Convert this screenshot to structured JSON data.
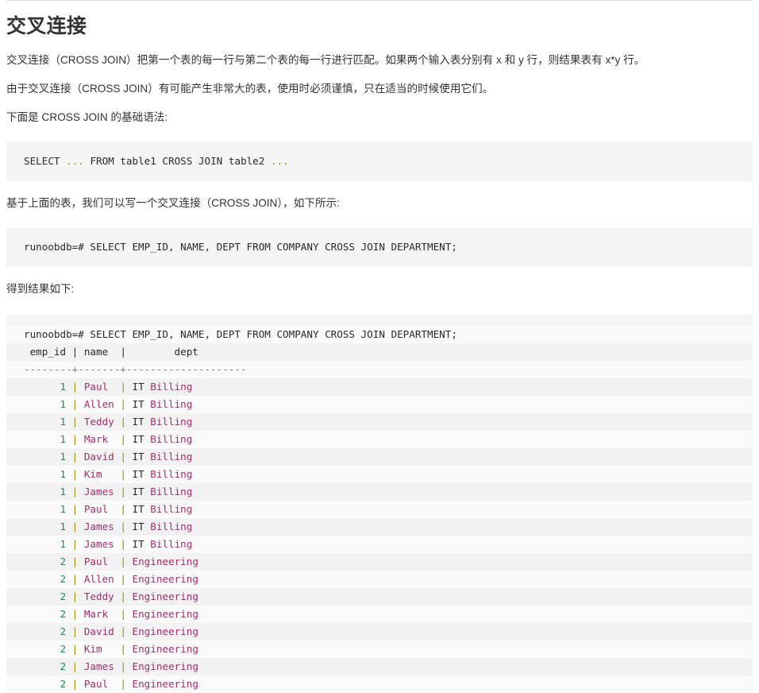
{
  "page": {
    "title": "交叉连接",
    "paragraphs": [
      "交叉连接（CROSS JOIN）把第一个表的每一行与第二个表的每一行进行匹配。如果两个输入表分别有 x 和 y 行，则结果表有 x*y 行。",
      "由于交叉连接（CROSS JOIN）有可能产生非常大的表，使用时必须谨慎，只在适当的时候使用它们。",
      "下面是 CROSS JOIN 的基础语法:",
      "基于上面的表，我们可以写一个交叉连接（CROSS JOIN），如下所示:",
      "得到结果如下:"
    ]
  },
  "syntax_code": {
    "line": "SELECT ... FROM table1 CROSS JOIN table2 ...",
    "keyword_select": "SELECT",
    "dots1": "...",
    "rest": "FROM table1 CROSS JOIN table2",
    "dots2": "..."
  },
  "example_code": {
    "line": "runoobdb=# SELECT EMP_ID, NAME, DEPT FROM COMPANY CROSS JOIN DEPARTMENT;"
  },
  "result": {
    "prompt_line": "runoobdb=# SELECT EMP_ID, NAME, DEPT FROM COMPANY CROSS JOIN DEPARTMENT;",
    "header": " emp_id | name  |        dept",
    "separator": "--------+-------+--------------------",
    "columns": [
      "emp_id",
      "name",
      "dept"
    ],
    "rows": [
      {
        "emp_id": "1",
        "name": "Paul ",
        "dept_plain": "IT ",
        "dept_hl": "Billing"
      },
      {
        "emp_id": "1",
        "name": "Allen",
        "dept_plain": "IT ",
        "dept_hl": "Billing"
      },
      {
        "emp_id": "1",
        "name": "Teddy",
        "dept_plain": "IT ",
        "dept_hl": "Billing"
      },
      {
        "emp_id": "1",
        "name": "Mark ",
        "dept_plain": "IT ",
        "dept_hl": "Billing"
      },
      {
        "emp_id": "1",
        "name": "David",
        "dept_plain": "IT ",
        "dept_hl": "Billing"
      },
      {
        "emp_id": "1",
        "name": "Kim  ",
        "dept_plain": "IT ",
        "dept_hl": "Billing"
      },
      {
        "emp_id": "1",
        "name": "James",
        "dept_plain": "IT ",
        "dept_hl": "Billing"
      },
      {
        "emp_id": "1",
        "name": "Paul ",
        "dept_plain": "IT ",
        "dept_hl": "Billing"
      },
      {
        "emp_id": "1",
        "name": "James",
        "dept_plain": "IT ",
        "dept_hl": "Billing"
      },
      {
        "emp_id": "1",
        "name": "James",
        "dept_plain": "IT ",
        "dept_hl": "Billing"
      },
      {
        "emp_id": "2",
        "name": "Paul ",
        "dept_plain": "",
        "dept_hl": "Engineering"
      },
      {
        "emp_id": "2",
        "name": "Allen",
        "dept_plain": "",
        "dept_hl": "Engineering"
      },
      {
        "emp_id": "2",
        "name": "Teddy",
        "dept_plain": "",
        "dept_hl": "Engineering"
      },
      {
        "emp_id": "2",
        "name": "Mark ",
        "dept_plain": "",
        "dept_hl": "Engineering"
      },
      {
        "emp_id": "2",
        "name": "David",
        "dept_plain": "",
        "dept_hl": "Engineering"
      },
      {
        "emp_id": "2",
        "name": "Kim  ",
        "dept_plain": "",
        "dept_hl": "Engineering"
      },
      {
        "emp_id": "2",
        "name": "James",
        "dept_plain": "",
        "dept_hl": "Engineering"
      },
      {
        "emp_id": "2",
        "name": "Paul ",
        "dept_plain": "",
        "dept_hl": "Engineering"
      }
    ]
  },
  "colors": {
    "code_bg": "#f5f5f5",
    "row_odd": "#f2f2f2",
    "row_even": "#fafafa",
    "number": "#198c5a",
    "pipe": "#9a8b12",
    "string": "#9c2f6e",
    "plain": "#24292e",
    "rule": "#dddddd"
  }
}
